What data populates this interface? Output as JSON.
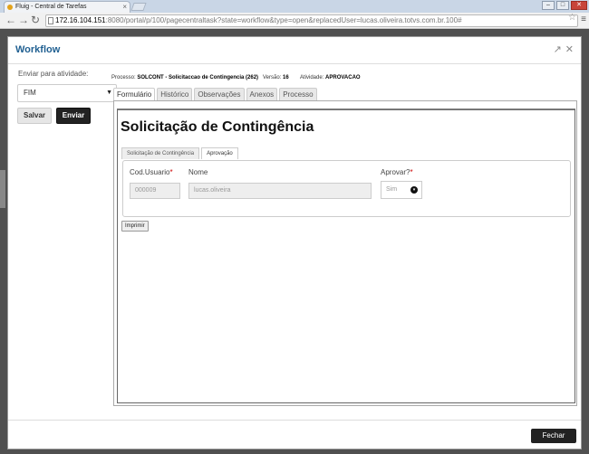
{
  "browser": {
    "tab_title": "Fluig - Central de Tarefas",
    "url_host": "172.16.104.151",
    "url_rest": ":8080/portal/p/100/pagecentraltask?state=workflow&type=open&replacedUser=lucas.oliveira.totvs.com.br.100#",
    "tab_close": "×"
  },
  "modal": {
    "title": "Workflow",
    "header_icons": [
      "↗",
      "✕"
    ],
    "send_to_label": "Enviar para atividade:",
    "activity_select": "FIM",
    "save_label": "Salvar",
    "send_label": "Enviar",
    "close_label": "Fechar"
  },
  "meta": {
    "process_label": "Processo:",
    "process_value": "SOLCONT - Solicitaccao de Contingencia (262)",
    "version_label": "Versão:",
    "version_value": "16",
    "activity_label": "Atividade:",
    "activity_value": "APROVACAO"
  },
  "main_tabs": [
    "Formulário",
    "Histórico",
    "Observações",
    "Anexos",
    "Processo"
  ],
  "form": {
    "title": "Solicitação de Contingência",
    "sub_tabs": [
      "Solicitação de Contingência",
      "Aprovação"
    ],
    "fields": {
      "cod_label": "Cod.Usuario",
      "cod_value": "000009",
      "nome_label": "Nome",
      "nome_value": "lucas.oliveira",
      "aprovar_label": "Aprovar?",
      "aprovar_value": "Sim"
    },
    "required_mark": "*",
    "print_label": "Imprimir"
  }
}
